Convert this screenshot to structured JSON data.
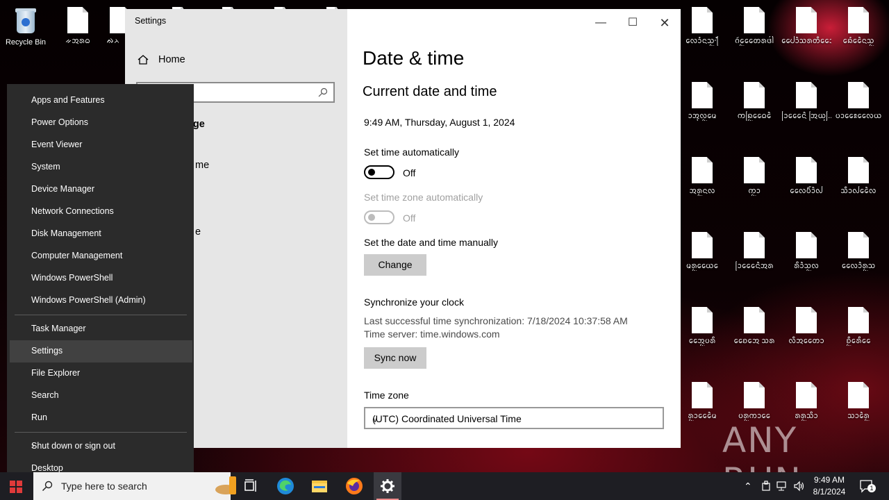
{
  "desktop": {
    "recycle_bin": "Recycle Bin",
    "left_icons": [
      "ᨀᩋᩁᨵ",
      "ᨁᨂ"
    ],
    "grid_labels": [
      [
        "ᩃᩮᩴᩣᨶᩈᩬ·ᩕᩴ",
        "ᨣᩢᩮᩬᨲᩯᩁᨴᩤ",
        "ᨸᩯᩣᩫᩈᩁᨲᩥᩯᩣ",
        "ᨦᩮᩴᩯᩫᨶᩈᩬ"
      ],
      [
        "ᩣᩋᩩᩃᩬᨾᩮ",
        "ᨠᨦᩕᩬᨵᩯᩮᩫ",
        "ᩕᩣᩯᩮᨶᩫ ᩒᨿᩭ...",
        "ᨷᩣᩯᩡᩃᩯᨿ"
      ],
      [
        "ᩋᩁᩬᨶᩃ",
        "ᨠᩬᩣ",
        "ᩃᩯᨷᩥᩴᩣᩫᩓ",
        "ᩈᩥᩣᩓᩯᩫᩃ"
      ],
      [
        "ᨾᩁᩬᨿᩯᩮ",
        "ᩕᩣᩯᩮᨶᩫᩋᩁ",
        "ᩁᩥᩣᩫᩈᩬᩃ",
        "ᩃᩯᩣᩫᩁᩬᩈ"
      ],
      [
        "ᩋᩯᩬᨷᩁᩥ",
        "ᨧᩯᩋᩮ ᩈᩁ",
        "ᩃᩥᩋᨲᩯᩣ",
        "ᨧᩥᩬᩁᩮᩥᩯ"
      ],
      [
        "ᩁᩬᩣᩯᩮᩫᨾ",
        "ᨷᩁᩬᨠᩣᩯ",
        "ᩁᩁᩬᩈᩥᩣ",
        "ᩈᩣᩮᩫᩁᩬ"
      ]
    ]
  },
  "settings": {
    "title": "Settings",
    "home": "Home",
    "search_placeholder_fragment": "ng",
    "side_fragments": [
      "uage",
      "me",
      "e"
    ],
    "page_title": "Date & time",
    "section_title": "Current date and time",
    "current_datetime": "9:49 AM, Thursday, August 1, 2024",
    "set_time_auto_label": "Set time automatically",
    "set_time_auto_state": "Off",
    "set_tz_auto_label": "Set time zone automatically",
    "set_tz_auto_state": "Off",
    "manual_label": "Set the date and time manually",
    "change_button": "Change",
    "sync_title": "Synchronize your clock",
    "last_sync": "Last successful time synchronization: 7/18/2024 10:37:58 AM",
    "time_server": "Time server: time.windows.com",
    "sync_button": "Sync now",
    "timezone_label": "Time zone",
    "timezone_value": "(UTC) Coordinated Universal Time"
  },
  "winx_menu": {
    "group1": [
      "Apps and Features",
      "Power Options",
      "Event Viewer",
      "System",
      "Device Manager",
      "Network Connections",
      "Disk Management",
      "Computer Management",
      "Windows PowerShell",
      "Windows PowerShell (Admin)"
    ],
    "group2": [
      "Task Manager",
      "Settings",
      "File Explorer",
      "Search",
      "Run"
    ],
    "group3": [
      "Shut down or sign out",
      "Desktop"
    ],
    "highlighted": "Settings"
  },
  "taskbar": {
    "search_placeholder": "Type here to search",
    "time": "9:49 AM",
    "date": "8/1/2024",
    "notification_count": "1"
  },
  "watermark": "ANY RUN"
}
